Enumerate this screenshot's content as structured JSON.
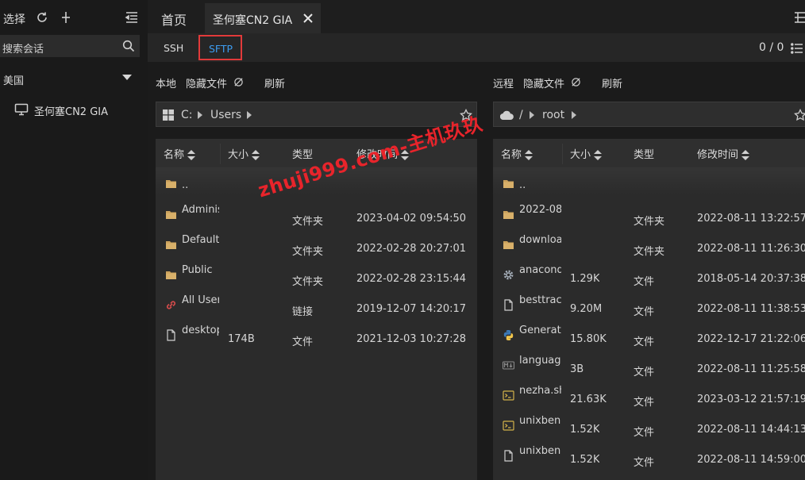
{
  "sidebar": {
    "select_label": "选择",
    "search_placeholder": "搜索会话",
    "group_label": "美国",
    "session_label": "圣何塞CN2 GIA"
  },
  "tabs": {
    "home_label": "首页",
    "active_label": "圣何塞CN2 GIA"
  },
  "subtabs": {
    "ssh_label": "SSH",
    "sftp_label": "SFTP",
    "counter": "0 / 0",
    "highlight_color": "#e23a3a",
    "active_color": "#3d9cf0"
  },
  "local": {
    "title": "本地",
    "hide_files": "隐藏文件",
    "refresh": "刷新",
    "path": [
      "C:",
      "Users"
    ],
    "columns": {
      "name": "名称",
      "size": "大小",
      "type": "类型",
      "mtime": "修改时间"
    },
    "rows": [
      {
        "icon": "folder-icon",
        "name": "..",
        "size": "",
        "type": "",
        "mtime": ""
      },
      {
        "icon": "folder-icon",
        "name": "Adminis",
        "size": "",
        "type": "文件夹",
        "mtime": "2023-04-02 09:54:50"
      },
      {
        "icon": "folder-icon",
        "name": "Default",
        "size": "",
        "type": "文件夹",
        "mtime": "2022-02-28 20:27:01"
      },
      {
        "icon": "folder-icon",
        "name": "Public",
        "size": "",
        "type": "文件夹",
        "mtime": "2022-02-28 23:15:44"
      },
      {
        "icon": "link-icon",
        "name": "All User",
        "size": "",
        "type": "链接",
        "mtime": "2019-12-07 14:20:17"
      },
      {
        "icon": "file-icon",
        "name": "desktop",
        "size": "174B",
        "type": "文件",
        "mtime": "2021-12-03 10:27:28"
      }
    ]
  },
  "remote": {
    "title": "远程",
    "hide_files": "隐藏文件",
    "refresh": "刷新",
    "path": [
      "/",
      "root"
    ],
    "columns": {
      "name": "名称",
      "size": "大小",
      "type": "类型",
      "mtime": "修改时间"
    },
    "rows": [
      {
        "icon": "folder-icon",
        "name": "..",
        "size": "",
        "type": "",
        "mtime": ""
      },
      {
        "icon": "folder-icon",
        "name": "2022-08",
        "size": "",
        "type": "文件夹",
        "mtime": "2022-08-11 13:22:57"
      },
      {
        "icon": "folder-icon",
        "name": "downloa",
        "size": "",
        "type": "文件夹",
        "mtime": "2022-08-11 11:26:30"
      },
      {
        "icon": "gear-icon",
        "name": "anacond",
        "size": "1.29K",
        "type": "文件",
        "mtime": "2018-05-14 20:37:38"
      },
      {
        "icon": "file-icon",
        "name": "besttrac",
        "size": "9.20M",
        "type": "文件",
        "mtime": "2022-08-11 11:38:53"
      },
      {
        "icon": "python-icon",
        "name": "Generate",
        "size": "15.80K",
        "type": "文件",
        "mtime": "2022-12-17 21:22:06"
      },
      {
        "icon": "markdown-icon",
        "name": "language",
        "size": "3B",
        "type": "文件",
        "mtime": "2022-08-11 11:25:58"
      },
      {
        "icon": "terminal-icon",
        "name": "nezha.sh",
        "size": "21.63K",
        "type": "文件",
        "mtime": "2023-03-12 21:57:19"
      },
      {
        "icon": "terminal-icon",
        "name": "unixbenc",
        "size": "1.52K",
        "type": "文件",
        "mtime": "2022-08-11 14:44:13"
      },
      {
        "icon": "file-icon",
        "name": "unixbenc",
        "size": "1.52K",
        "type": "文件",
        "mtime": "2022-08-11 14:59:00"
      }
    ]
  },
  "watermark": "zhuji999.com-主机玖玖"
}
